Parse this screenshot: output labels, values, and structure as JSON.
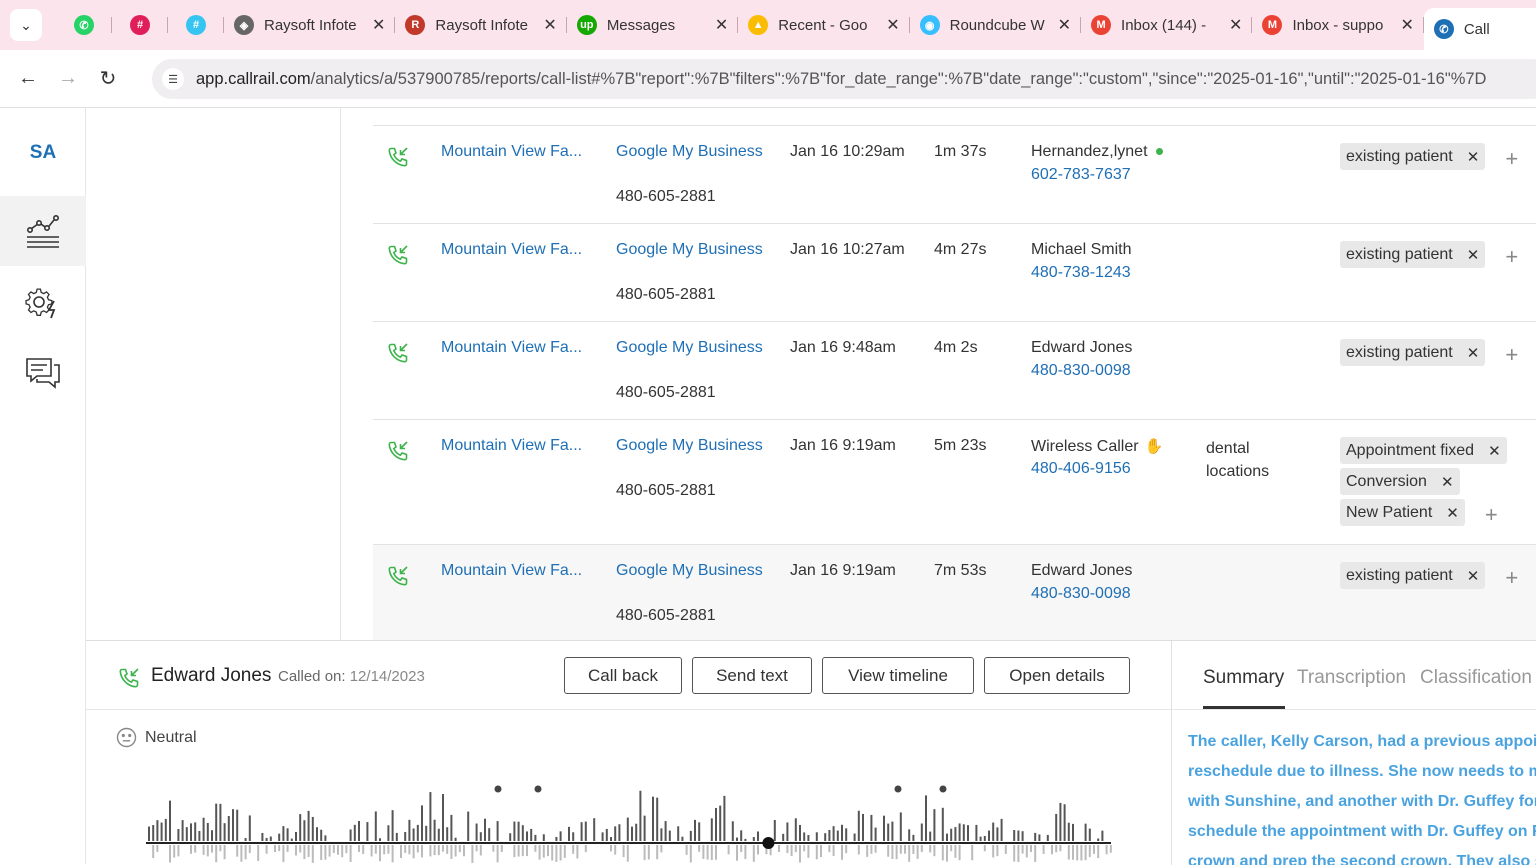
{
  "browser": {
    "tabs": [
      {
        "icon": "whatsapp-icon",
        "color": "#25d366",
        "title": "",
        "closable": false
      },
      {
        "icon": "slack-icon",
        "color": "#e01e5a",
        "title": "",
        "closable": false
      },
      {
        "icon": "slack-icon",
        "color": "#36c5f0",
        "title": "",
        "closable": false
      },
      {
        "icon": "globe-icon",
        "color": "#666666",
        "title": "Raysoft Infote",
        "closable": true
      },
      {
        "icon": "raysoft-icon",
        "color": "#c0392b",
        "title": "Raysoft Infote",
        "closable": true
      },
      {
        "icon": "upwork-icon",
        "color": "#14a800",
        "title": "Messages",
        "closable": true
      },
      {
        "icon": "google-drive-icon",
        "color": "#fbbc04",
        "title": "Recent - Goo",
        "closable": true
      },
      {
        "icon": "roundcube-icon",
        "color": "#37beff",
        "title": "Roundcube W",
        "closable": true
      },
      {
        "icon": "gmail-icon",
        "color": "#ea4335",
        "title": "Inbox (144) -",
        "closable": true
      },
      {
        "icon": "gmail-icon",
        "color": "#ea4335",
        "title": "Inbox - suppo",
        "closable": true
      },
      {
        "icon": "callrail-icon",
        "color": "#1f6fb5",
        "title": "Call",
        "closable": false
      }
    ],
    "url_host": "app.callrail.com",
    "url_path": "/analytics/a/537900785/reports/call-list#%7B\"report\":%7B\"filters\":%7B\"for_date_range\":%7B\"date_range\":\"custom\",\"since\":\"2025-01-16\",\"until\":\"2025-01-16\"%7D"
  },
  "sidebar": {
    "logo": "SA",
    "items": [
      {
        "name": "analytics-icon",
        "active": true
      },
      {
        "name": "settings-icon",
        "active": false
      },
      {
        "name": "chat-icon",
        "active": false
      }
    ]
  },
  "calls": [
    {
      "company": "Mountain View Fa...",
      "source": "Google My Business",
      "tracking": "480-605-2881",
      "date": "Jan 16 10:29am",
      "duration": "1m 37s",
      "name": "Hernandez,lynet",
      "badge": "dot",
      "phone": "602-783-7637",
      "keywords": "",
      "tags": [
        "existing patient"
      ]
    },
    {
      "company": "Mountain View Fa...",
      "source": "Google My Business",
      "tracking": "480-605-2881",
      "date": "Jan 16 10:27am",
      "duration": "4m 27s",
      "name": "Michael Smith",
      "badge": "",
      "phone": "480-738-1243",
      "keywords": "",
      "tags": [
        "existing patient"
      ]
    },
    {
      "company": "Mountain View Fa...",
      "source": "Google My Business",
      "tracking": "480-605-2881",
      "date": "Jan 16 9:48am",
      "duration": "4m 2s",
      "name": "Edward Jones",
      "badge": "",
      "phone": "480-830-0098",
      "keywords": "",
      "tags": [
        "existing patient"
      ]
    },
    {
      "company": "Mountain View Fa...",
      "source": "Google My Business",
      "tracking": "480-605-2881",
      "date": "Jan 16 9:19am",
      "duration": "5m 23s",
      "name": "Wireless Caller",
      "badge": "thumb",
      "phone": "480-406-9156",
      "keywords": "dental locations",
      "tags": [
        "Appointment fixed",
        "Conversion",
        "New Patient"
      ]
    },
    {
      "company": "Mountain View Fa...",
      "source": "Google My Business",
      "tracking": "480-605-2881",
      "date": "Jan 16 9:19am",
      "duration": "7m 53s",
      "name": "Edward Jones",
      "badge": "",
      "phone": "480-830-0098",
      "keywords": "",
      "tags": [
        "existing patient"
      ]
    }
  ],
  "detail": {
    "caller": "Edward Jones",
    "called_label": "Called on:",
    "called_date": "12/14/2023",
    "buttons": {
      "call_back": "Call back",
      "send_text": "Send text",
      "view_timeline": "View timeline",
      "open_details": "Open details"
    },
    "sentiment": "Neutral",
    "playback_progress": 0.645,
    "tabs": {
      "summary": "Summary",
      "transcription": "Transcription",
      "classification": "Classification"
    },
    "summary_lines": [
      "The caller, Kelly Carson, had a previous appoin",
      "reschedule due to illness. She now needs to ma",
      "with Sunshine, and another with Dr. Guffey for",
      "schedule the appointment with Dr. Guffey on F",
      "crown and prep the second crown. They also s"
    ]
  },
  "colors": {
    "link": "#1f6fb5",
    "accent_green": "#3cb44b",
    "summary_text": "#4aa3df",
    "tabbar_bg": "#fce4ec"
  }
}
